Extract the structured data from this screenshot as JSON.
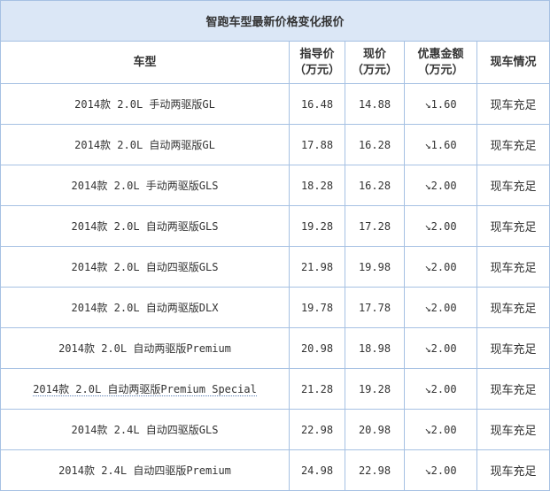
{
  "table": {
    "title": "智跑车型最新价格变化报价",
    "headers": {
      "model": "车型",
      "guide_line1": "指导价",
      "guide_line2": "（万元）",
      "current_line1": "现价",
      "current_line2": "（万元）",
      "discount_line1": "优惠金额",
      "discount_line2": "（万元）",
      "stock": "现车情况"
    },
    "rows": [
      {
        "model": "2014款 2.0L 手动两驱版GL",
        "guide": "16.48",
        "current": "14.88",
        "discount": "↘1.60",
        "stock": "现车充足"
      },
      {
        "model": "2014款 2.0L 自动两驱版GL",
        "guide": "17.88",
        "current": "16.28",
        "discount": "↘1.60",
        "stock": "现车充足"
      },
      {
        "model": "2014款 2.0L 手动两驱版GLS",
        "guide": "18.28",
        "current": "16.28",
        "discount": "↘2.00",
        "stock": "现车充足"
      },
      {
        "model": "2014款 2.0L 自动两驱版GLS",
        "guide": "19.28",
        "current": "17.28",
        "discount": "↘2.00",
        "stock": "现车充足"
      },
      {
        "model": "2014款 2.0L 自动四驱版GLS",
        "guide": "21.98",
        "current": "19.98",
        "discount": "↘2.00",
        "stock": "现车充足"
      },
      {
        "model": "2014款 2.0L 自动两驱版DLX",
        "guide": "19.78",
        "current": "17.78",
        "discount": "↘2.00",
        "stock": "现车充足"
      },
      {
        "model": "2014款 2.0L 自动两驱版Premium",
        "guide": "20.98",
        "current": "18.98",
        "discount": "↘2.00",
        "stock": "现车充足"
      },
      {
        "model": "2014款 2.0L 自动两驱版Premium Special",
        "guide": "21.28",
        "current": "19.28",
        "discount": "↘2.00",
        "stock": "现车充足"
      },
      {
        "model": "2014款 2.4L 自动四驱版GLS",
        "guide": "22.98",
        "current": "20.98",
        "discount": "↘2.00",
        "stock": "现车充足"
      },
      {
        "model": "2014款 2.4L 自动四驱版Premium",
        "guide": "24.98",
        "current": "22.98",
        "discount": "↘2.00",
        "stock": "现车充足"
      }
    ]
  }
}
